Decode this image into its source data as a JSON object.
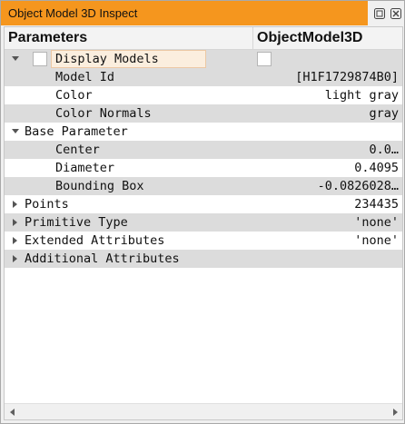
{
  "window": {
    "title": "Object Model 3D Inspect"
  },
  "header": {
    "col1": "Parameters",
    "col2": "ObjectModel3D"
  },
  "rows": [
    {
      "label": "Display Models",
      "value": "",
      "level": 1,
      "expander": "expanded",
      "checkbox": true,
      "shaded": true
    },
    {
      "label": "Model Id",
      "value": "[H1F1729874B0]",
      "level": 2,
      "shaded": true
    },
    {
      "label": "Color",
      "value": "light gray",
      "level": 2,
      "shaded": false
    },
    {
      "label": "Color Normals",
      "value": "gray",
      "level": 2,
      "shaded": true
    },
    {
      "label": "Base Parameter",
      "value": "",
      "level": 0,
      "expander": "expanded",
      "shaded": false
    },
    {
      "label": "Center",
      "value": "0.0…",
      "level": 2,
      "shaded": true
    },
    {
      "label": "Diameter",
      "value": "0.4095",
      "level": 2,
      "shaded": false
    },
    {
      "label": "Bounding Box",
      "value": "-0.0826028…",
      "level": 2,
      "shaded": true
    },
    {
      "label": "Points",
      "value": "234435",
      "level": 0,
      "expander": "collapsed",
      "shaded": false
    },
    {
      "label": "Primitive Type",
      "value": "'none'",
      "level": 0,
      "expander": "collapsed",
      "shaded": true
    },
    {
      "label": "Extended Attributes",
      "value": "'none'",
      "level": 0,
      "expander": "collapsed",
      "shaded": false
    },
    {
      "label": "Additional Attributes",
      "value": "",
      "level": 0,
      "expander": "collapsed",
      "shaded": true
    }
  ],
  "icons": {
    "float": "float-window-icon",
    "close": "close-icon",
    "expanded": "triangle-down-icon",
    "collapsed": "triangle-right-icon",
    "scroll_left": "scroll-left-icon",
    "scroll_right": "scroll-right-icon"
  },
  "colors": {
    "title_accent": "#f5961e",
    "row_shade": "#dcdcdc"
  }
}
